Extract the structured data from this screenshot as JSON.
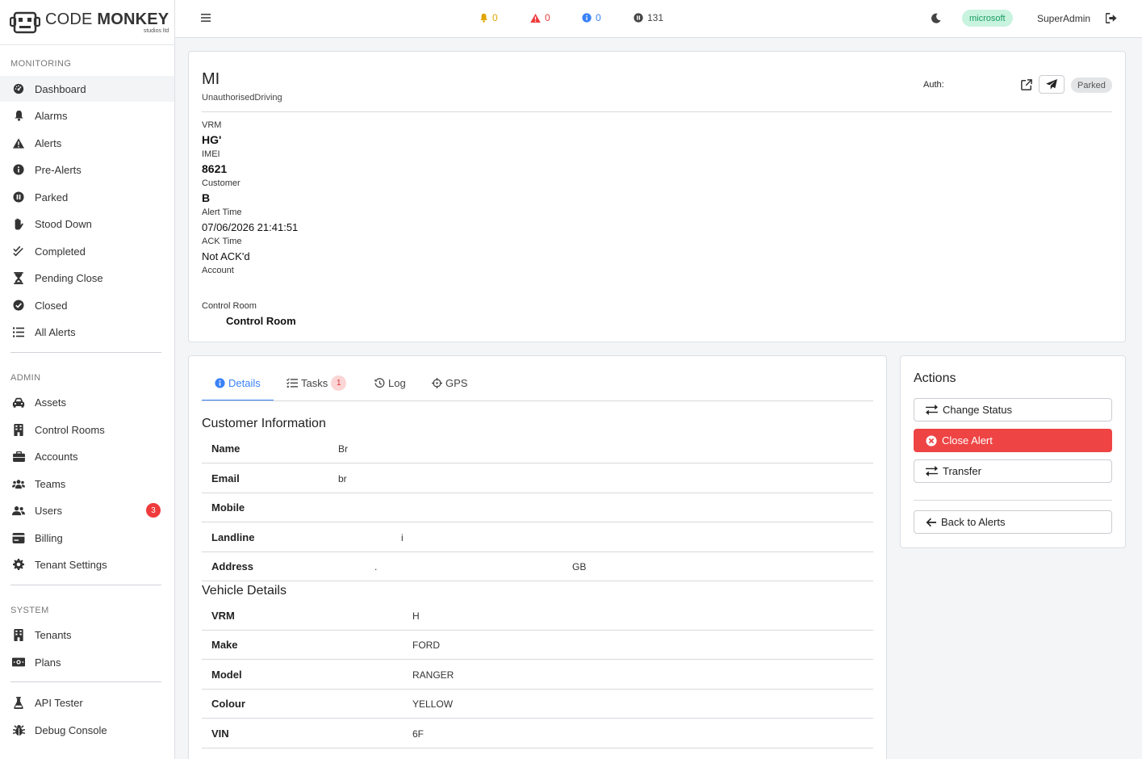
{
  "brand": {
    "name_light": "CODE",
    "name_bold": "MONKEY",
    "subtitle": "studios ltd"
  },
  "sidebar": {
    "sections": {
      "monitoring": "MONITORING",
      "admin": "ADMIN",
      "system": "SYSTEM"
    },
    "monitoring_items": [
      {
        "label": "Dashboard",
        "icon": "gauge-icon"
      },
      {
        "label": "Alarms",
        "icon": "bell-icon"
      },
      {
        "label": "Alerts",
        "icon": "warning-icon"
      },
      {
        "label": "Pre-Alerts",
        "icon": "info-circle-icon"
      },
      {
        "label": "Parked",
        "icon": "pause-circle-icon"
      },
      {
        "label": "Stood Down",
        "icon": "hand-icon"
      },
      {
        "label": "Completed",
        "icon": "double-check-icon"
      },
      {
        "label": "Pending Close",
        "icon": "hourglass-icon"
      },
      {
        "label": "Closed",
        "icon": "check-circle-icon"
      },
      {
        "label": "All Alerts",
        "icon": "list-icon"
      }
    ],
    "admin_items": [
      {
        "label": "Assets",
        "icon": "car-icon"
      },
      {
        "label": "Control Rooms",
        "icon": "building-icon"
      },
      {
        "label": "Accounts",
        "icon": "briefcase-icon"
      },
      {
        "label": "Teams",
        "icon": "team-icon"
      },
      {
        "label": "Users",
        "icon": "users-icon",
        "badge": "3"
      },
      {
        "label": "Billing",
        "icon": "billing-icon"
      },
      {
        "label": "Tenant Settings",
        "icon": "gear-icon"
      }
    ],
    "system_items": [
      {
        "label": "Tenants",
        "icon": "building-icon"
      },
      {
        "label": "Plans",
        "icon": "money-icon"
      }
    ],
    "tools_items": [
      {
        "label": "API Tester",
        "icon": "flask-icon"
      },
      {
        "label": "Debug Console",
        "icon": "bug-icon"
      }
    ]
  },
  "topbar": {
    "alarms_count": "0",
    "alerts_count": "0",
    "prealerts_count": "0",
    "parked_count": "131",
    "tenant": "microsoft",
    "user": "SuperAdmin",
    "colors": {
      "alarm": "#e0a500",
      "alert": "#ef3b3b",
      "prealert": "#3b82f6",
      "parked": "#444444"
    }
  },
  "alert": {
    "title": "MI",
    "type": "UnauthorisedDriving",
    "auth_label": "Auth:",
    "status": "Parked",
    "fields": {
      "vrm_label": "VRM",
      "vrm": "HG'",
      "imei_label": "IMEI",
      "imei": "8621",
      "customer_label": "Customer",
      "customer": "B",
      "alert_time_label": "Alert Time",
      "alert_time": "07/06/2026 21:41:51",
      "ack_time_label": "ACK Time",
      "ack_time": "Not ACK'd",
      "account_label": "Account",
      "control_room_label": "Control Room",
      "control_room": "Control Room"
    }
  },
  "tabs": [
    {
      "label": "Details",
      "icon": "info-circle-icon"
    },
    {
      "label": "Tasks",
      "icon": "tasks-icon",
      "badge": "1"
    },
    {
      "label": "Log",
      "icon": "history-icon"
    },
    {
      "label": "GPS",
      "icon": "crosshair-icon"
    }
  ],
  "customer_info": {
    "title": "Customer Information",
    "rows": [
      {
        "key": "Name",
        "value": "Br"
      },
      {
        "key": "Email",
        "value": "br"
      },
      {
        "key": "Mobile",
        "value": ""
      },
      {
        "key": "Landline",
        "value": "i"
      },
      {
        "key": "Address",
        "value": ".",
        "value2": "GB"
      }
    ]
  },
  "vehicle": {
    "title": "Vehicle Details",
    "rows": [
      {
        "key": "VRM",
        "value": "H"
      },
      {
        "key": "Make",
        "value": "FORD"
      },
      {
        "key": "Model",
        "value": "RANGER"
      },
      {
        "key": "Colour",
        "value": "YELLOW"
      },
      {
        "key": "VIN",
        "value": "6F"
      }
    ]
  },
  "actions": {
    "title": "Actions",
    "change_status": "Change Status",
    "close_alert": "Close Alert",
    "transfer": "Transfer",
    "back": "Back to Alerts",
    "danger_color": "#ee4444"
  }
}
